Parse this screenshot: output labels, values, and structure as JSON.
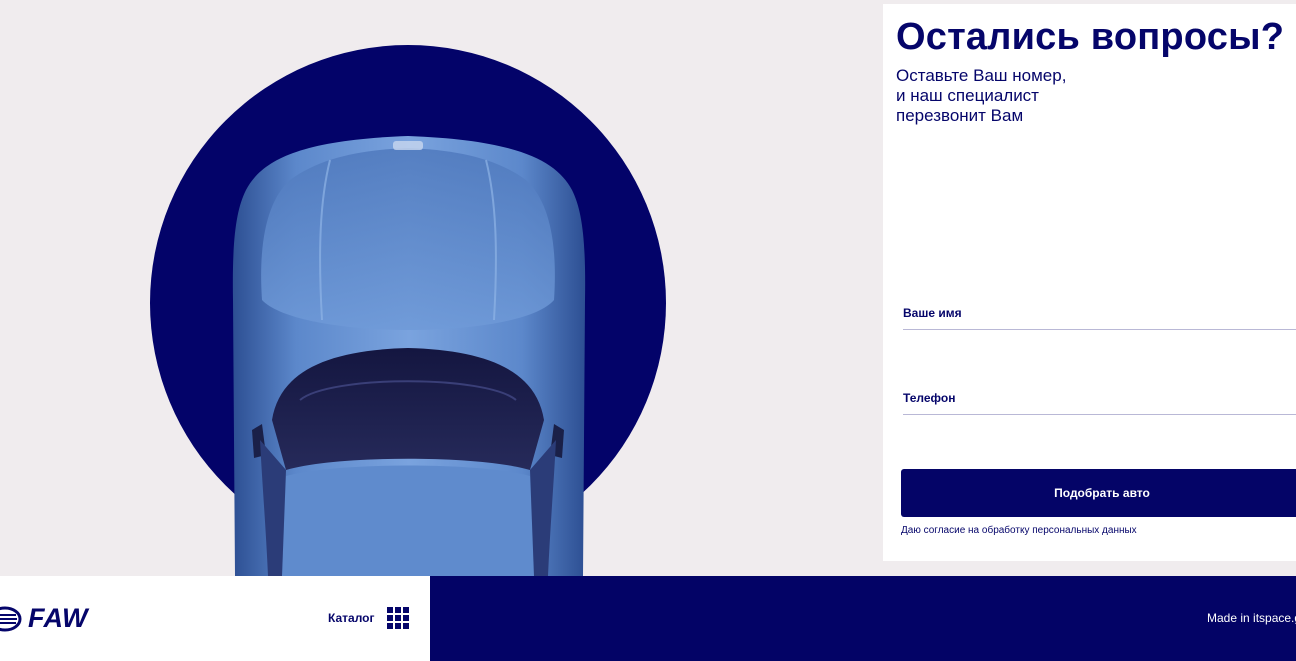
{
  "form": {
    "title": "Остались вопросы?",
    "subtitle_line1": "Оставьте Ваш номер,",
    "subtitle_line2": "и наш специалист",
    "subtitle_line3": "перезвонит Вам",
    "name_placeholder": "Ваше имя",
    "phone_placeholder": "Телефон",
    "submit_label": "Подобрать авто",
    "consent_text": "Даю согласие на обработку персональных данных"
  },
  "footer": {
    "brand": "FAW",
    "catalog_label": "Каталог",
    "made_in": "Made in itspace.g"
  },
  "colors": {
    "brand_navy": "#030366",
    "car_blue": "#5d89cb",
    "background": "#f0ecee"
  },
  "icons": {
    "catalog": "grid-icon",
    "logo_emblem": "faw-emblem-icon"
  }
}
